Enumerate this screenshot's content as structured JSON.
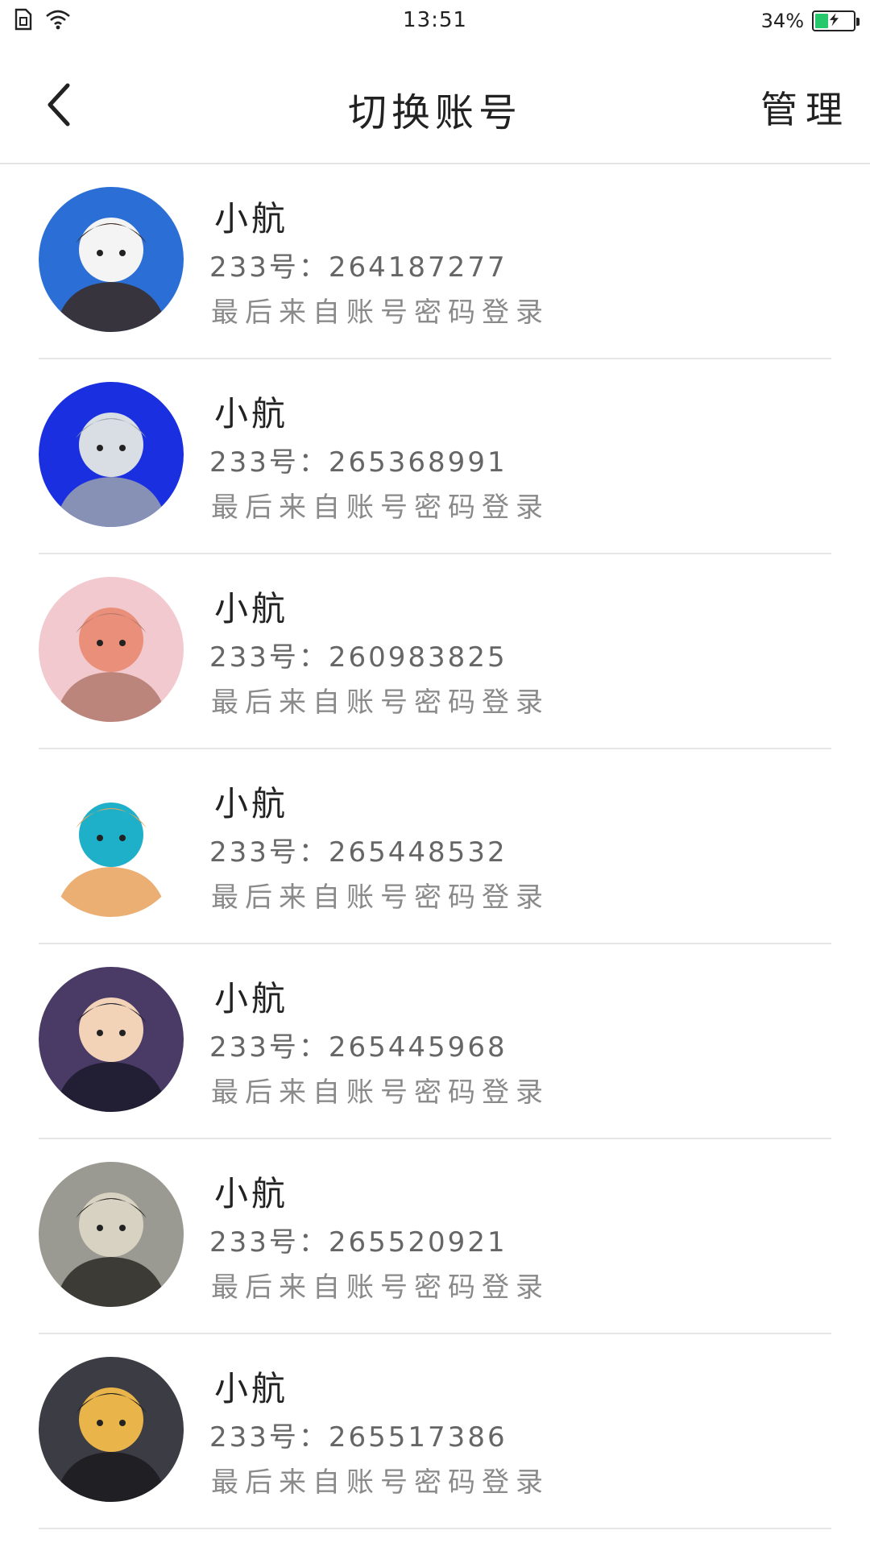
{
  "status_bar": {
    "time": "13:51",
    "battery_text": "34%",
    "battery_level": 0.34,
    "icons": [
      "sim-icon",
      "wifi-icon",
      "battery-icon"
    ]
  },
  "header": {
    "title": "切换账号",
    "manage_label": "管理",
    "back_icon": "chevron-left-icon"
  },
  "accounts": [
    {
      "name": "小航",
      "id_text": "233号：264187277",
      "note": "最后来自账号密码登录",
      "avatar_palette": [
        "#2b6fd6",
        "#f4f4f4",
        "#3a2a22"
      ]
    },
    {
      "name": "小航",
      "id_text": "233号：265368991",
      "note": "最后来自账号密码登录",
      "avatar_palette": [
        "#1a2fe0",
        "#d9dde4",
        "#9aa2ad"
      ]
    },
    {
      "name": "小航",
      "id_text": "233号：260983825",
      "note": "最后来自账号密码登录",
      "avatar_palette": [
        "#f1c9cf",
        "#e98f7a",
        "#b3796c"
      ]
    },
    {
      "name": "小航",
      "id_text": "233号：265448532",
      "note": "最后来自账号密码登录",
      "avatar_palette": [
        "#ffffff",
        "#1fb0c9",
        "#e7a15a"
      ]
    },
    {
      "name": "小航",
      "id_text": "233号：265445968",
      "note": "最后来自账号密码登录",
      "avatar_palette": [
        "#4a3b66",
        "#f2d3b8",
        "#1b1b2b"
      ]
    },
    {
      "name": "小航",
      "id_text": "233号：265520921",
      "note": "最后来自账号密码登录",
      "avatar_palette": [
        "#9a9a92",
        "#d8d2c2",
        "#2d2a26"
      ]
    },
    {
      "name": "小航",
      "id_text": "233号：265517386",
      "note": "最后来自账号密码登录",
      "avatar_palette": [
        "#3c3c44",
        "#e9b44a",
        "#1a1a1f"
      ]
    }
  ],
  "colors": {
    "divider": "#e6e6e6",
    "battery_fill": "#25c86a",
    "text_primary": "#222222",
    "text_secondary": "#8a8a8a"
  }
}
